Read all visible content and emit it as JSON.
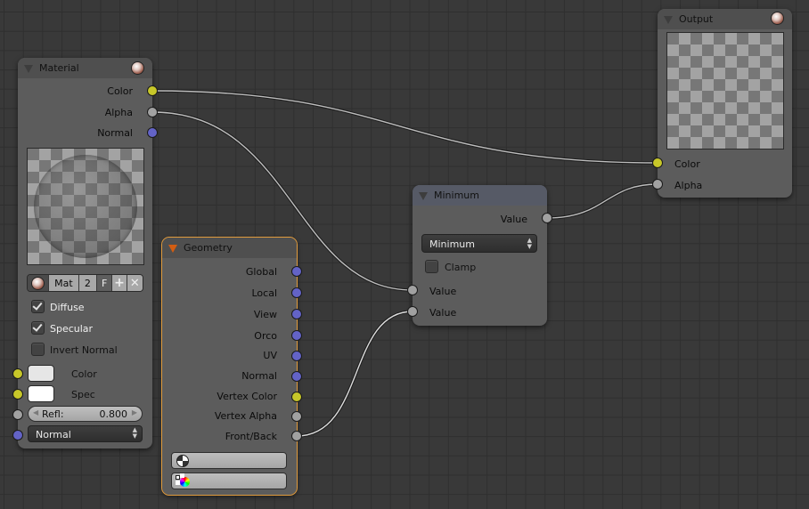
{
  "colors": {
    "background": "#393939",
    "node_body": "#5c5c5c",
    "socket_color": "#c7c729",
    "socket_value": "#a1a1a1",
    "socket_vector": "#6363c7",
    "selected_outline": "#e09b3d"
  },
  "material_node": {
    "title": "Material",
    "outputs": [
      {
        "label": "Color",
        "type": "color"
      },
      {
        "label": "Alpha",
        "type": "value"
      },
      {
        "label": "Normal",
        "type": "vector"
      }
    ],
    "id_block": {
      "name": "Mat",
      "users": "2",
      "fake": "F",
      "add_icon": "plus-icon",
      "remove_icon": "x-icon"
    },
    "checkboxes": [
      {
        "label": "Diffuse",
        "checked": true
      },
      {
        "label": "Specular",
        "checked": true
      },
      {
        "label": "Invert Normal",
        "checked": false
      }
    ],
    "inputs": [
      {
        "label": "Color",
        "type": "color",
        "swatch": "#e6e6e6"
      },
      {
        "label": "Spec",
        "type": "color",
        "swatch": "#ffffff"
      },
      {
        "label": "Refl:",
        "type": "value",
        "value": "0.800"
      },
      {
        "label": "Normal",
        "type": "vector",
        "dropdown": true
      }
    ]
  },
  "geometry_node": {
    "title": "Geometry",
    "outputs": [
      {
        "label": "Global",
        "type": "vector"
      },
      {
        "label": "Local",
        "type": "vector"
      },
      {
        "label": "View",
        "type": "vector"
      },
      {
        "label": "Orco",
        "type": "vector"
      },
      {
        "label": "UV",
        "type": "vector"
      },
      {
        "label": "Normal",
        "type": "vector"
      },
      {
        "label": "Vertex Color",
        "type": "color"
      },
      {
        "label": "Vertex Alpha",
        "type": "value"
      },
      {
        "label": "Front/Back",
        "type": "value"
      }
    ],
    "fields": [
      {
        "icon": "uv-map-icon",
        "value": ""
      },
      {
        "icon": "vertex-color-icon",
        "value": ""
      }
    ]
  },
  "minimum_node": {
    "title": "Minimum",
    "output": {
      "label": "Value",
      "type": "value"
    },
    "operation": "Minimum",
    "clamp": {
      "label": "Clamp",
      "checked": false
    },
    "inputs": [
      {
        "label": "Value",
        "type": "value"
      },
      {
        "label": "Value",
        "type": "value"
      }
    ]
  },
  "output_node": {
    "title": "Output",
    "inputs": [
      {
        "label": "Color",
        "type": "color"
      },
      {
        "label": "Alpha",
        "type": "value"
      }
    ]
  },
  "links": [
    {
      "from": "Material.Color",
      "to": "Output.Color"
    },
    {
      "from": "Material.Alpha",
      "to": "Minimum.Value1"
    },
    {
      "from": "Geometry.Front/Back",
      "to": "Minimum.Value2"
    },
    {
      "from": "Minimum.Value",
      "to": "Output.Alpha"
    }
  ]
}
